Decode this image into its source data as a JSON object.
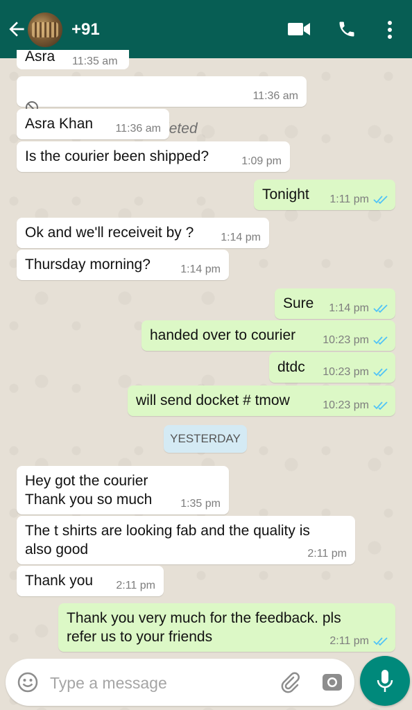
{
  "header": {
    "contact_title": "+91"
  },
  "partial_message": {
    "text": "Asra",
    "time": "11:35 am"
  },
  "messages": [
    {
      "text": "This message was deleted",
      "time": "11:36 am"
    },
    {
      "text": "Asra Khan",
      "time": "11:36 am"
    },
    {
      "text": "Is the courier been shipped?",
      "time": "1:09 pm"
    },
    {
      "text": "Tonight",
      "time": "1:11 pm"
    },
    {
      "text": "Ok and we'll receiveit by ?",
      "time": "1:14 pm"
    },
    {
      "text": "Thursday morning?",
      "time": "1:14 pm"
    },
    {
      "text": "Sure",
      "time": "1:14 pm"
    },
    {
      "text": "handed over to courier",
      "time": "10:23 pm"
    },
    {
      "text": "dtdc",
      "time": "10:23 pm"
    },
    {
      "text": "will send docket # tmow",
      "time": "10:23 pm"
    },
    {
      "text": "Hey got the courier\nThank you so much",
      "time": "1:35 pm"
    },
    {
      "text": "The t shirts are looking fab and the quality is\nalso good",
      "time": "2:11 pm"
    },
    {
      "text": "Thank you",
      "time": "2:11 pm"
    },
    {
      "text": "Thank you very much for the feedback. pls\nrefer us to your friends",
      "time": "2:11 pm"
    }
  ],
  "day_separator": "YESTERDAY",
  "input": {
    "placeholder": "Type a message"
  },
  "icons": {
    "back": "arrow-left-icon",
    "video": "video-call-icon",
    "phone": "phone-icon",
    "menu": "more-vert-icon",
    "emoji": "emoji-icon",
    "attach": "paperclip-icon",
    "camera": "camera-icon",
    "mic": "mic-icon",
    "read_receipt": "double-check-icon",
    "deleted": "ban-icon"
  },
  "colors": {
    "header": "#075e54",
    "outgoing_bubble": "#dcf8c6",
    "incoming_bubble": "#ffffff",
    "read_ticks": "#4fc3f7",
    "mic_button": "#00897b",
    "day_badge": "#d4eaf4"
  }
}
